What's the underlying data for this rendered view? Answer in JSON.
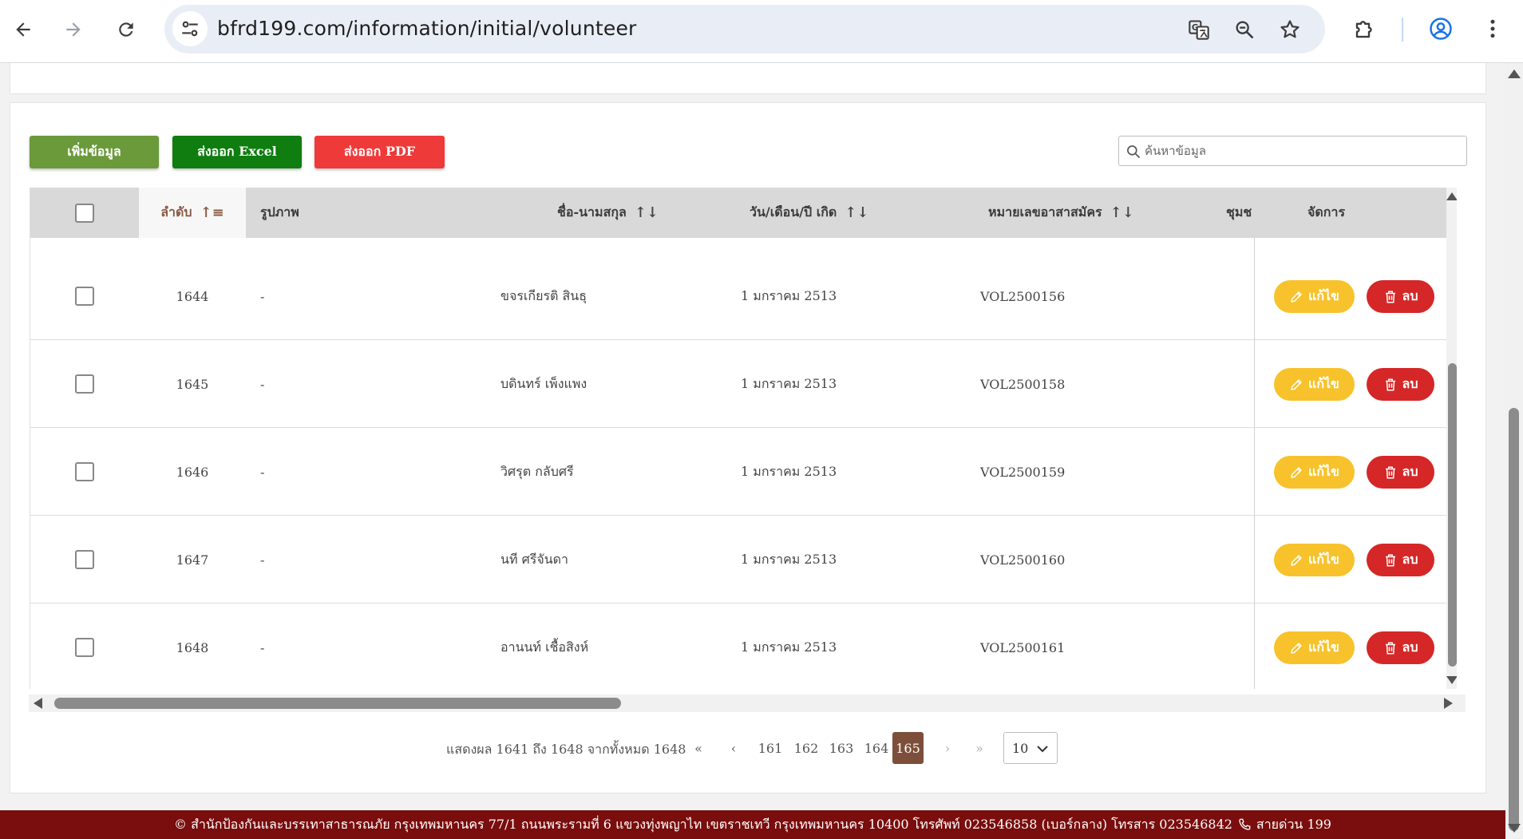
{
  "browser": {
    "url": "bfrd199.com/information/initial/volunteer"
  },
  "toolbar": {
    "add_label": "เพิ่มข้อมูล",
    "excel_label": "ส่งออก Excel",
    "pdf_label": "ส่งออก PDF",
    "search_placeholder": "ค้นหาข้อมูล"
  },
  "table": {
    "headers": {
      "order": "ลำดับ",
      "photo": "รูปภาพ",
      "name": "ชื่อ-นามสกุล",
      "birth": "วัน/เดือน/ปี เกิด",
      "volunteer_no": "หมายเลขอาสาสมัคร",
      "community": "ชุมช",
      "actions": "จัดการ"
    },
    "rows": [
      {
        "order": "1644",
        "photo": "-",
        "name": "ขจรเกียรติ สินธุ",
        "birth": "1 มกราคม 2513",
        "volunteer_no": "VOL2500156"
      },
      {
        "order": "1645",
        "photo": "-",
        "name": "บดินทร์ เพ็งแพง",
        "birth": "1 มกราคม 2513",
        "volunteer_no": "VOL2500158"
      },
      {
        "order": "1646",
        "photo": "-",
        "name": "วิศรุต กลับศรี",
        "birth": "1 มกราคม 2513",
        "volunteer_no": "VOL2500159"
      },
      {
        "order": "1647",
        "photo": "-",
        "name": "นที ศรีจันดา",
        "birth": "1 มกราคม 2513",
        "volunteer_no": "VOL2500160"
      },
      {
        "order": "1648",
        "photo": "-",
        "name": "อานนท์ เชื้อสิงห์",
        "birth": "1 มกราคม 2513",
        "volunteer_no": "VOL2500161"
      }
    ],
    "edit_label": "แก้ไข",
    "delete_label": "ลบ"
  },
  "pagination": {
    "info": "แสดงผล 1641 ถึง 1648 จากทั้งหมด 1648",
    "pages": [
      "161",
      "162",
      "163",
      "164",
      "165"
    ],
    "active_page": "165",
    "page_size": "10"
  },
  "footer": {
    "text": "© สำนักป้องกันและบรรเทาสาธารณภัย กรุงเทพมหานคร 77/1 ถนนพระรามที่ 6 แขวงทุ่งพญาไท เขตราชเทวี กรุงเทพมหานคร 10400 โทรศัพท์ 023546858 (เบอร์กลาง) โทรสาร 023546842",
    "hotline": "สายด่วน 199"
  },
  "colors": {
    "add": "#6a9a3a",
    "excel": "#0f7d0f",
    "pdf": "#ef3a3a",
    "edit": "#f7c22b",
    "delete": "#d52727",
    "active_page": "#7d4f3a",
    "footer": "#7a0d0d"
  },
  "icons": {
    "back": "arrow-left-icon",
    "forward": "arrow-right-icon",
    "reload": "reload-icon",
    "site_info": "tune-icon",
    "translate": "translate-icon",
    "zoom": "zoom-icon",
    "bookmark": "star-icon",
    "extensions": "puzzle-icon",
    "profile": "account-icon",
    "menu": "kebab-icon"
  }
}
